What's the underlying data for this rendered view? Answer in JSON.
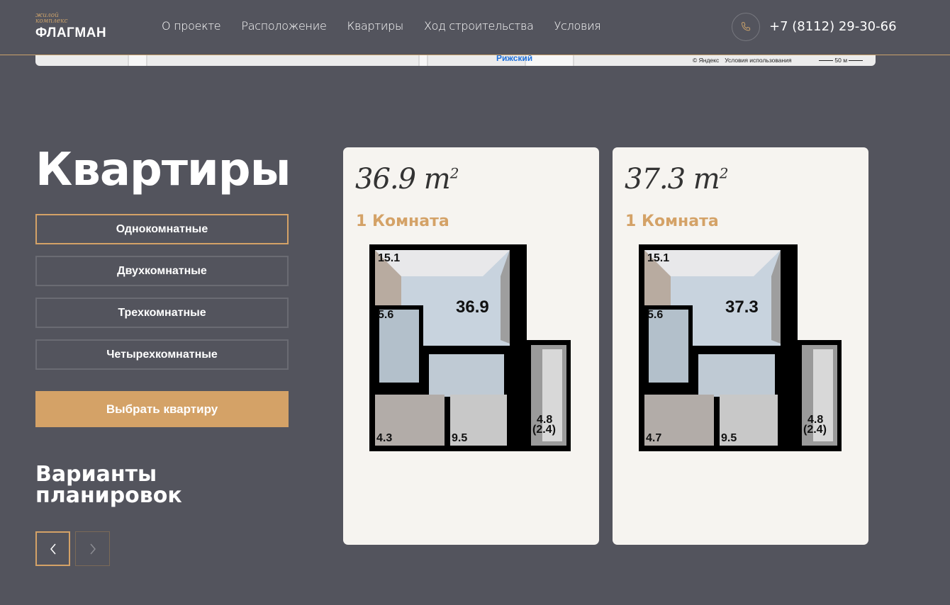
{
  "header": {
    "logo_small": "жилой комплекс",
    "logo_main": "ФЛАГМАН",
    "nav": [
      "О проекте",
      "Расположение",
      "Квартиры",
      "Ход строительства",
      "Условия"
    ],
    "phone": "+7 (8112) 29-30-66"
  },
  "map": {
    "label": "Рижский",
    "copyright": "© Яндекс",
    "terms": "Условия использования",
    "scale": "50 м"
  },
  "section": {
    "title": "Квартиры",
    "filters": [
      "Однокомнатные",
      "Двухкомнатные",
      "Трехкомнатные",
      "Четырехкомнатные"
    ],
    "active_filter": "Однокомнатные",
    "choose_button": "Выбрать квартиру",
    "subtitle": "Варианты планировок"
  },
  "cards": [
    {
      "area": "36.9",
      "unit": "m",
      "unit_sup": "2",
      "rooms": "1 Комната",
      "plan": {
        "room": "15.1",
        "total": "36.9",
        "bath": "5.6",
        "wc": "4.3",
        "kitchen": "9.5",
        "balcony": "4.8",
        "balcony_half": "(2.4)"
      }
    },
    {
      "area": "37.3",
      "unit": "m",
      "unit_sup": "2",
      "rooms": "1 Комната",
      "plan": {
        "room": "15.1",
        "total": "37.3",
        "bath": "5.6",
        "wc": "4.7",
        "kitchen": "9.5",
        "balcony": "4.8",
        "balcony_half": "(2.4)"
      }
    }
  ],
  "colors": {
    "background": "#53545d",
    "accent": "#d4a267",
    "card": "#f6f4f0"
  }
}
